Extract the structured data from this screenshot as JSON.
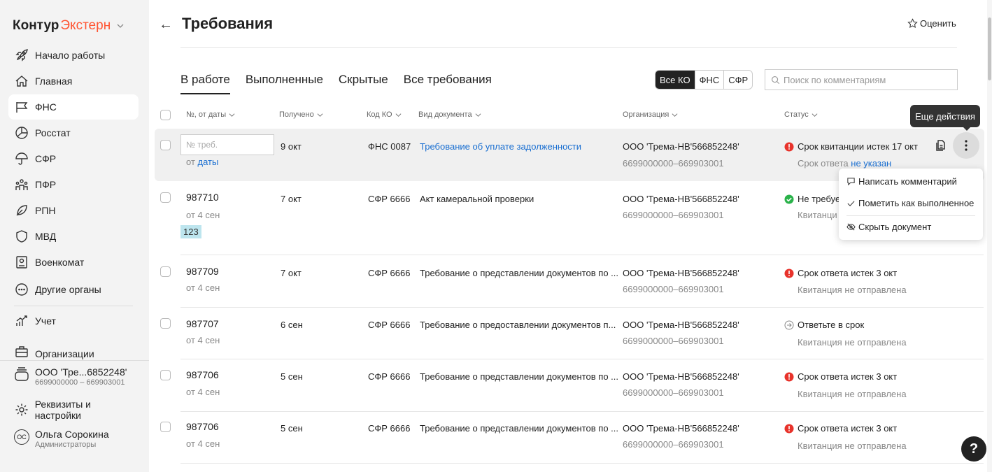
{
  "brand": {
    "part1": "Контур",
    "part2": "Экстерн"
  },
  "sidebar": {
    "items": [
      {
        "label": "Начало работы",
        "icon": "rocket-icon"
      },
      {
        "label": "Главная",
        "icon": "home-icon"
      },
      {
        "label": "ФНС",
        "icon": "flag-icon",
        "active": true
      },
      {
        "label": "Росстат",
        "icon": "pie-chart-icon"
      },
      {
        "label": "СФР",
        "icon": "umbrella-icon"
      },
      {
        "label": "ПФР",
        "icon": "people-icon"
      },
      {
        "label": "РПН",
        "icon": "leaf-icon"
      },
      {
        "label": "МВД",
        "icon": "shield-icon"
      },
      {
        "label": "Военкомат",
        "icon": "id-card-icon"
      },
      {
        "label": "Другие органы",
        "icon": "more-circle-icon"
      },
      {
        "label": "Учет",
        "icon": "chart-icon"
      },
      {
        "label": "Организации",
        "icon": "briefcase-icon"
      }
    ],
    "org": {
      "name": "ООО 'Тре...6852248'",
      "inn": "6699000000 – 669903001"
    },
    "settings_label": "Реквизиты и настройки",
    "user": {
      "initials": "ОС",
      "name": "Ольга Сорокина",
      "role": "Администраторы"
    }
  },
  "header": {
    "title": "Требования",
    "rate_label": "Оценить"
  },
  "tabs": [
    "В работе",
    "Выполненные",
    "Скрытые",
    "Все требования"
  ],
  "segments": [
    "Все КО",
    "ФНС",
    "СФР"
  ],
  "search": {
    "placeholder": "Поиск по комментариям"
  },
  "columns": {
    "num": "№, от даты",
    "received": "Получено",
    "code": "Код КО",
    "doctype": "Вид документа",
    "org": "Организация",
    "status": "Статус"
  },
  "first_row": {
    "num_placeholder": "№ треб.",
    "date_prefix": "от",
    "date_link": "даты",
    "received": "9 окт",
    "code": "ФНС 0087",
    "doctype": "Требование об уплате задолженности",
    "org": "ООО 'Трема-НВ'566852248'",
    "inn": "6699000000–669903001",
    "status": "Срок квитанции истек 17 окт",
    "sub_prefix": "Срок ответа",
    "sub_link": "не указан"
  },
  "rows": [
    {
      "num": "987710",
      "date": "от 4 сен",
      "tag": "123",
      "received": "7 окт",
      "code": "СФР 6666",
      "doctype": "Акт камеральной проверки",
      "org": "ООО 'Трема-НВ'566852248'",
      "inn": "6699000000–669903001",
      "status": "Не требуе",
      "status_sub": "Квитанци"
    },
    {
      "num": "987709",
      "date": "от 4 сен",
      "received": "7 окт",
      "code": "СФР 6666",
      "doctype": "Требование о представлении документов по ...",
      "org": "ООО 'Трема-НВ'566852248'",
      "inn": "6699000000–669903001",
      "status": "Срок ответа истек 3 окт",
      "status_sub": "Квитанция не отправлена"
    },
    {
      "num": "987707",
      "date": "от 4 сен",
      "received": "6 сен",
      "code": "СФР 6666",
      "doctype": "Требование о предоставлении документов п...",
      "org": "ООО 'Трема-НВ'566852248'",
      "inn": "6699000000–669903001",
      "status": "Ответьте в срок",
      "status_sub": "Квитанция не отправлена"
    },
    {
      "num": "987706",
      "date": "от 4 сен",
      "received": "5 сен",
      "code": "СФР 6666",
      "doctype": "Требование о представлении документов по ...",
      "org": "ООО 'Трема-НВ'566852248'",
      "inn": "6699000000–669903001",
      "status": "Срок ответа истек 3 окт",
      "status_sub": "Квитанция не отправлена"
    },
    {
      "num": "987706",
      "date": "от 4 сен",
      "received": "5 сен",
      "code": "СФР 6666",
      "doctype": "Требование о представлении документов по ...",
      "org": "ООО 'Трема-НВ'566852248'",
      "inn": "6699000000–669903001",
      "status": "Срок ответа истек 3 окт",
      "status_sub": "Квитанция не отправлена"
    }
  ],
  "tooltip": "Еще действия",
  "menu": [
    "Написать комментарий",
    "Пометить как выполненное",
    "Скрыть документ"
  ],
  "help_label": "?",
  "colors": {
    "accent": "#ff5533",
    "link": "#1a6fd1",
    "error": "#e8332b",
    "success": "#2ab24a",
    "tag_bg": "#bde5ee"
  }
}
